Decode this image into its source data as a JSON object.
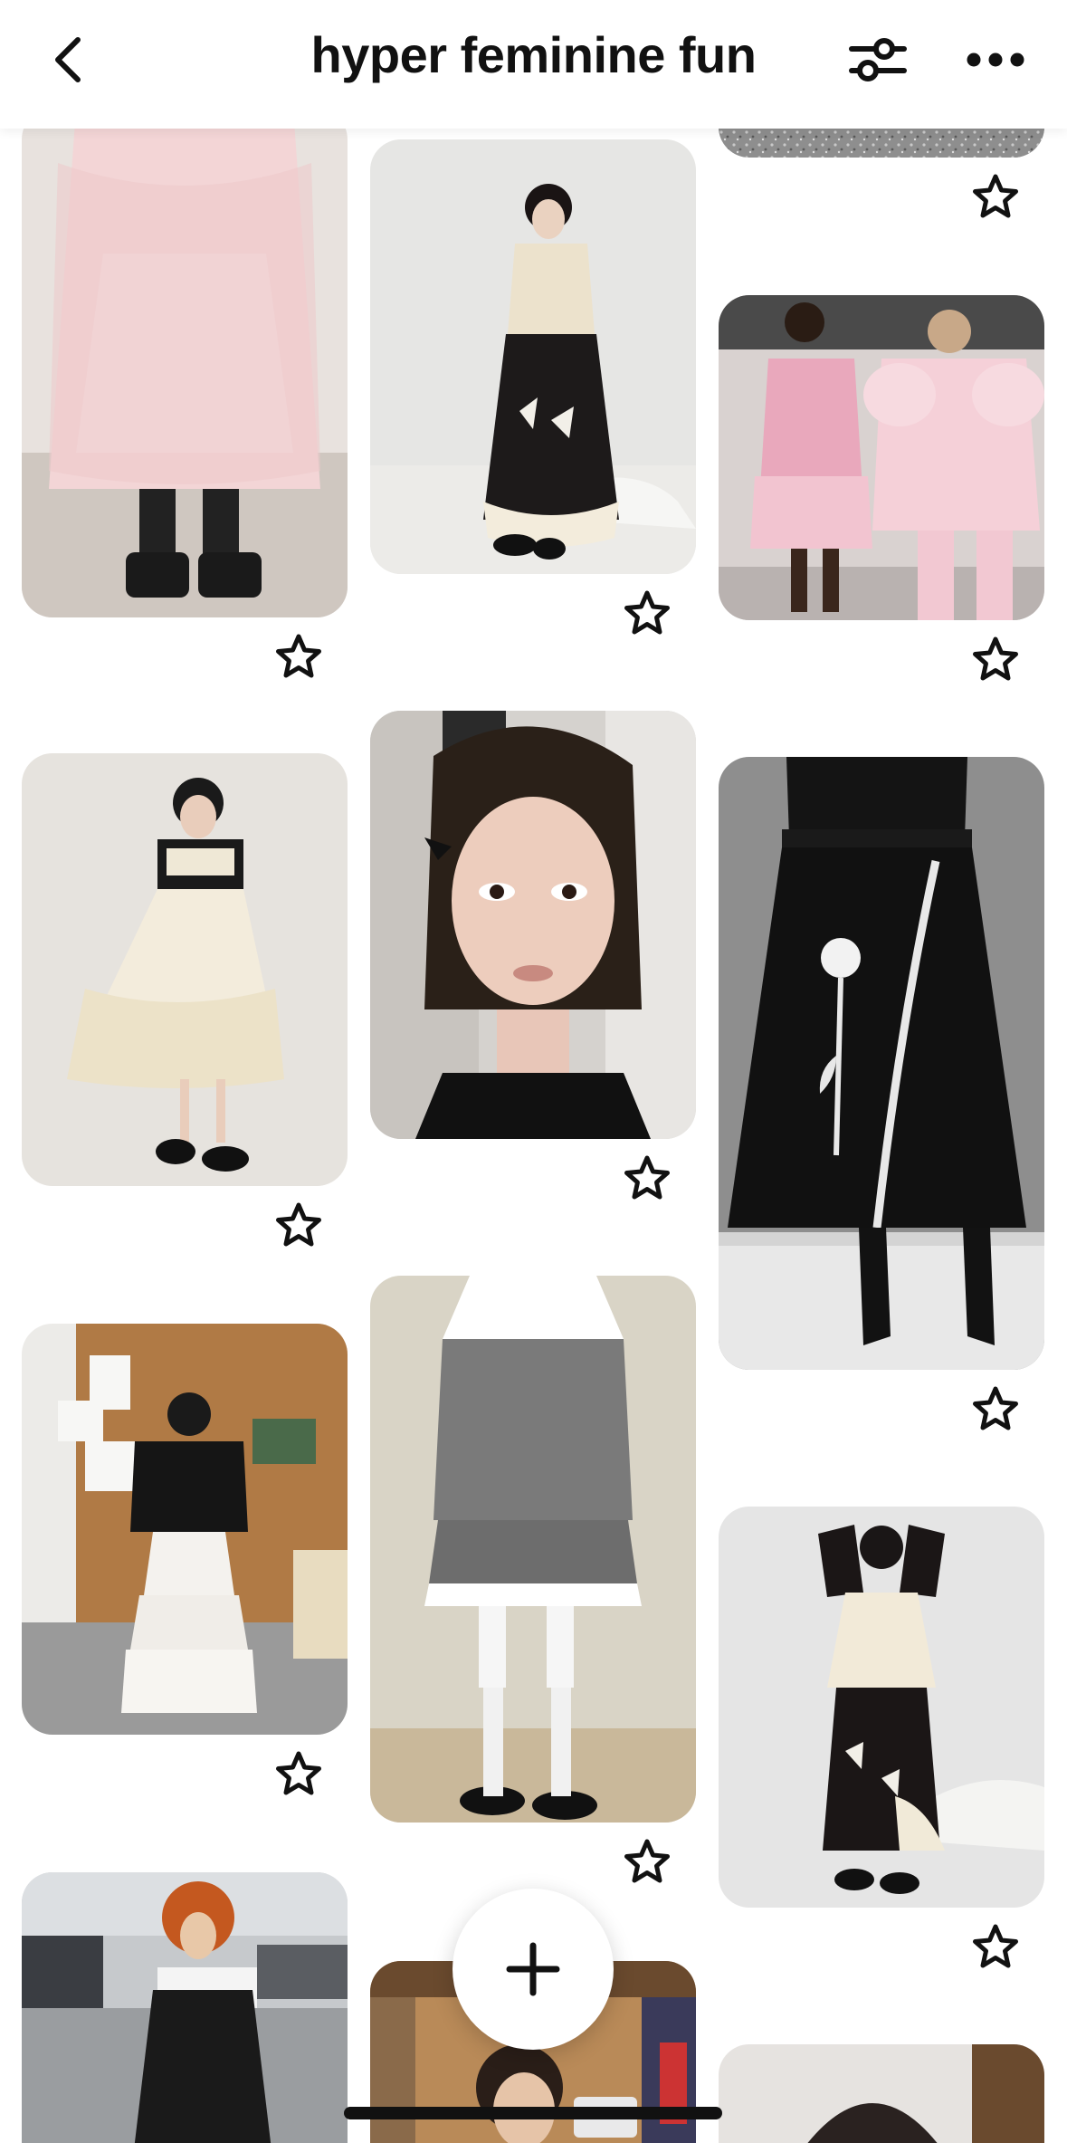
{
  "header": {
    "title": "hyper feminine fun",
    "back_icon": "chevron-left-icon",
    "filter_icon": "sliders-icon",
    "more_icon": "more-horizontal-icon"
  },
  "pins": [
    {
      "id": "pin-1",
      "description": "Pink ruffled dress with embroidered tulle and black platform boots",
      "colors": [
        "#f3d5d6",
        "#e9c0c4",
        "#2a2a2a"
      ]
    },
    {
      "id": "pin-2",
      "description": "Cream ruffled top with black bow skirt and tulle hem",
      "colors": [
        "#e6e6e4",
        "#ece2cc",
        "#1d1a1a"
      ]
    },
    {
      "id": "pin-3",
      "description": "Glittery silver fabric",
      "colors": [
        "#8a8a8a",
        "#b5b5b5",
        "#555555"
      ]
    },
    {
      "id": "pin-4",
      "description": "Runway models in pink textured outfits",
      "colors": [
        "#d9d2d0",
        "#efb8c8",
        "#f5d0d8"
      ]
    },
    {
      "id": "pin-5",
      "description": "Black top with cream tiered tulle dress",
      "colors": [
        "#e6e3de",
        "#efe8d6",
        "#1a1a1a"
      ]
    },
    {
      "id": "pin-6",
      "description": "Portrait with braids and black ribbon bows",
      "colors": [
        "#cfcac5",
        "#e8c6b8",
        "#1a1414"
      ]
    },
    {
      "id": "pin-7",
      "description": "Black maxi skirt with white rose appliqué",
      "colors": [
        "#8e8e8e",
        "#111111",
        "#e8e8e8"
      ]
    },
    {
      "id": "pin-8",
      "description": "Bomber jacket with tiered white skirt against cork board",
      "colors": [
        "#b07a45",
        "#e8e6e2",
        "#121212"
      ]
    },
    {
      "id": "pin-9",
      "description": "Grey pinstripe blazer and shorts with lace collar",
      "colors": [
        "#d7d3c8",
        "#7a7a7a",
        "#ffffff"
      ]
    },
    {
      "id": "pin-10",
      "description": "Black and cream tulle outfit with bows",
      "colors": [
        "#e5e5e5",
        "#f2ead8",
        "#1b1616"
      ]
    },
    {
      "id": "pin-11",
      "description": "Street style with red curly hair and black dress",
      "colors": [
        "#b9bcc0",
        "#c4581f",
        "#1a1a1a"
      ]
    },
    {
      "id": "pin-12",
      "description": "Portrait in warm-lit interior",
      "colors": [
        "#c89c6a",
        "#6a4a2e",
        "#e9d6bf"
      ]
    },
    {
      "id": "pin-13",
      "description": "Portrait with dark hair",
      "colors": [
        "#e6e3e0",
        "#2a2220",
        "#c8a888"
      ]
    }
  ],
  "star_icon": "star-outline-icon",
  "fab": {
    "icon": "plus-icon"
  },
  "accent": "#111111"
}
